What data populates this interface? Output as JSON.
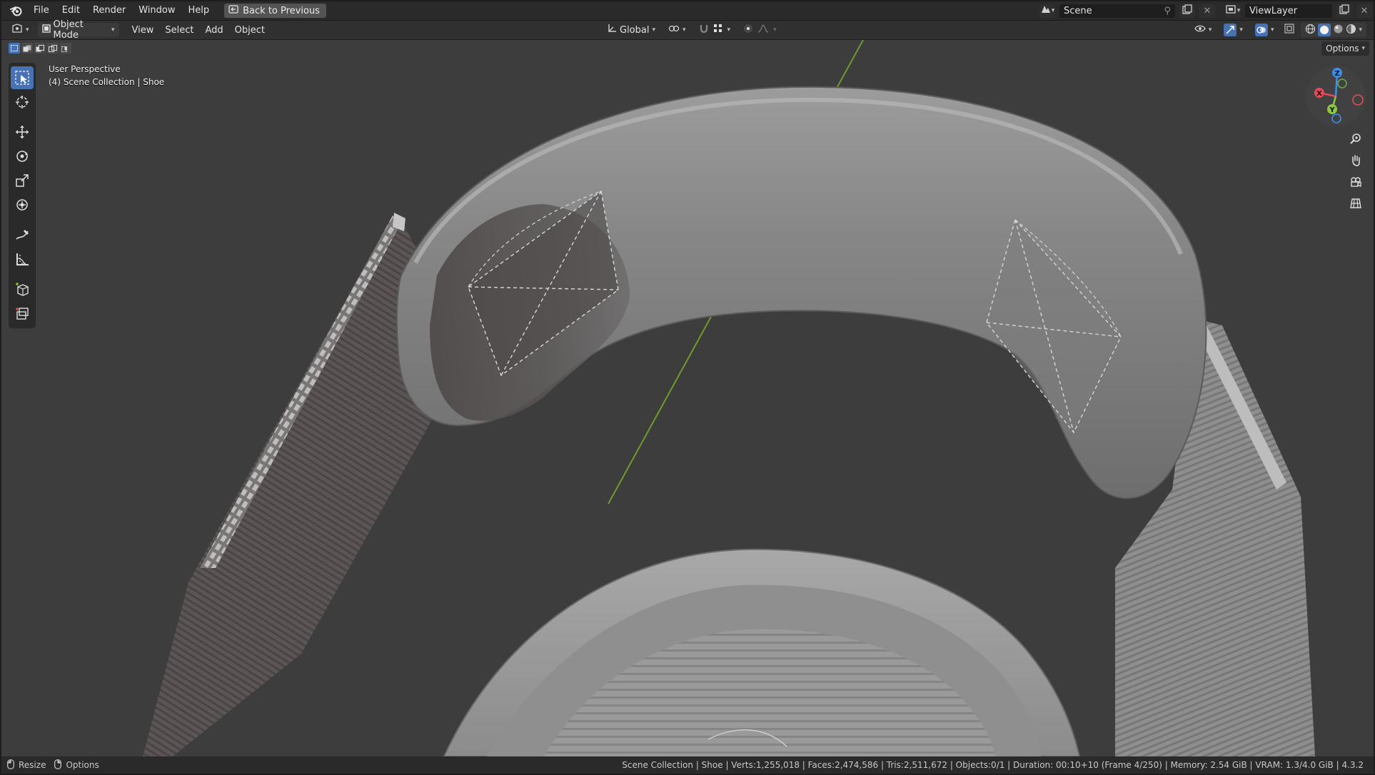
{
  "topbar": {
    "menus": [
      "File",
      "Edit",
      "Render",
      "Window",
      "Help"
    ],
    "back_button": "Back to Previous",
    "scene_name": "Scene",
    "view_layer": "ViewLayer"
  },
  "header": {
    "mode": "Object Mode",
    "menus": [
      "View",
      "Select",
      "Add",
      "Object"
    ],
    "transform_orientation": "Global"
  },
  "viewport": {
    "perspective": "User Perspective",
    "collection_path": "(4) Scene Collection | Shoe",
    "options_label": "Options",
    "gizmo_axes": {
      "x": "X",
      "y": "Y",
      "z": "Z"
    }
  },
  "toolbar": {
    "tools": [
      "select-box",
      "cursor",
      "move",
      "rotate",
      "scale",
      "transform",
      "annotate",
      "measure",
      "add-cube",
      "extrude-region"
    ],
    "active": "select-box"
  },
  "statusbar": {
    "left": [
      {
        "icon": "mouse-left-icon",
        "label": "Resize"
      },
      {
        "icon": "mouse-right-icon",
        "label": "Options"
      }
    ],
    "stats": "Scene Collection | Shoe | Verts:1,255,018 | Faces:2,474,586 | Tris:2,511,672 | Objects:0/1 | Duration: 00:10+10 (Frame 4/250) | Memory: 2.54 GiB | VRAM: 1.3/4.0 GiB | 4.3.2"
  },
  "colors": {
    "accent": "#4772b3",
    "axis_x": "#e34b5a",
    "axis_y": "#8cc63f",
    "axis_z": "#3d8ee6",
    "viewport_bg": "#3d3d3d",
    "green_axis_line": "#6e9a2e"
  }
}
